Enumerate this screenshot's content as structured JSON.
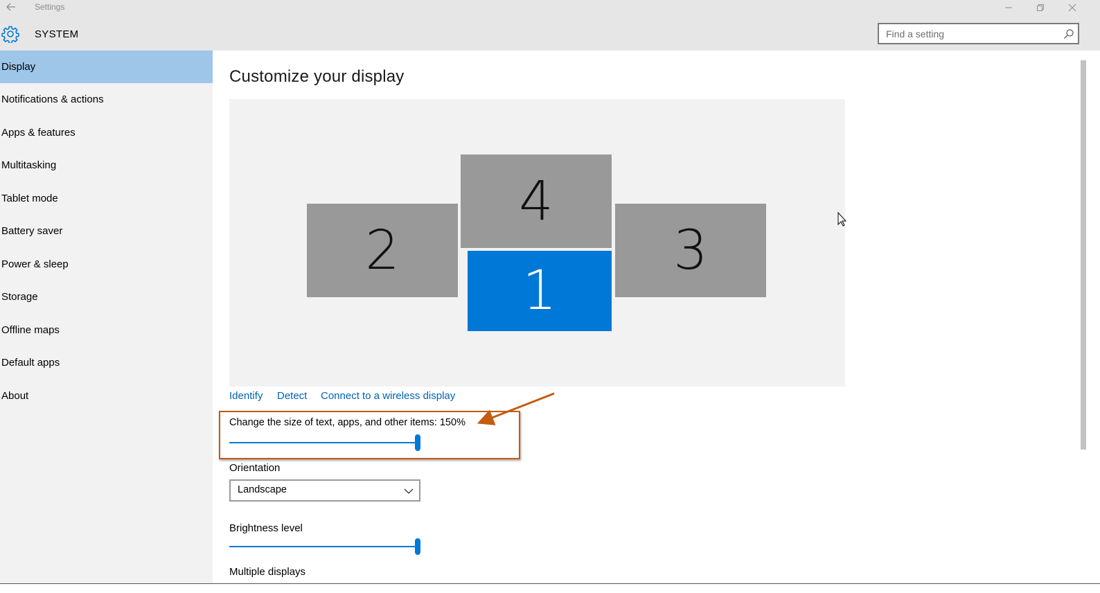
{
  "window": {
    "title": "Settings",
    "back_icon": "back-arrow-icon",
    "minimize_icon": "minimize-icon",
    "maximize_icon": "restore-icon",
    "close_icon": "close-icon"
  },
  "header": {
    "section_title": "SYSTEM",
    "section_icon": "gear-icon",
    "search": {
      "placeholder": "Find a setting",
      "value": "",
      "icon": "search-icon"
    }
  },
  "sidebar": {
    "items": [
      {
        "label": "Display",
        "selected": true
      },
      {
        "label": "Notifications & actions",
        "selected": false
      },
      {
        "label": "Apps & features",
        "selected": false
      },
      {
        "label": "Multitasking",
        "selected": false
      },
      {
        "label": "Tablet mode",
        "selected": false
      },
      {
        "label": "Battery saver",
        "selected": false
      },
      {
        "label": "Power & sleep",
        "selected": false
      },
      {
        "label": "Storage",
        "selected": false
      },
      {
        "label": "Offline maps",
        "selected": false
      },
      {
        "label": "Default apps",
        "selected": false
      },
      {
        "label": "About",
        "selected": false
      }
    ]
  },
  "main": {
    "title": "Customize your display",
    "monitors": [
      {
        "number": "2",
        "primary": false
      },
      {
        "number": "4",
        "primary": false
      },
      {
        "number": "1",
        "primary": true
      },
      {
        "number": "3",
        "primary": false
      }
    ],
    "links": {
      "identify": "Identify",
      "detect": "Detect",
      "wireless": "Connect to a wireless display"
    },
    "scaling": {
      "label": "Change the size of text, apps, and other items: 150%",
      "value_fraction": 1.0
    },
    "orientation": {
      "label": "Orientation",
      "selected": "Landscape",
      "icon": "chevron-down-icon"
    },
    "brightness": {
      "label": "Brightness level",
      "value_fraction": 1.0
    },
    "multiple_displays": {
      "label": "Multiple displays"
    }
  },
  "colors": {
    "accent": "#0078d7",
    "selected_nav": "#9dc6e9",
    "link": "#0063b1",
    "annotation": "#c55a11",
    "monitor_inactive": "#999999"
  }
}
